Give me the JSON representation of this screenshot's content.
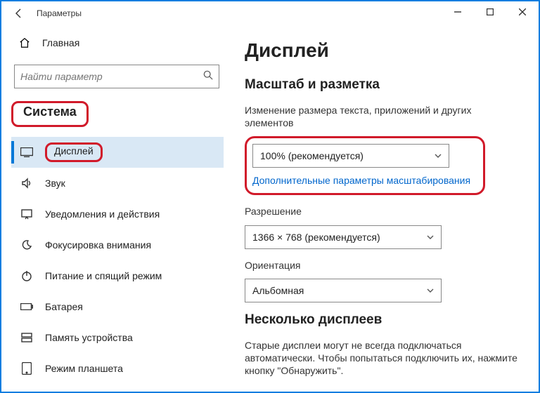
{
  "window": {
    "title": "Параметры"
  },
  "sidebar": {
    "home": "Главная",
    "search_placeholder": "Найти параметр",
    "category": "Система",
    "items": [
      {
        "label": "Дисплей"
      },
      {
        "label": "Звук"
      },
      {
        "label": "Уведомления и действия"
      },
      {
        "label": "Фокусировка внимания"
      },
      {
        "label": "Питание и спящий режим"
      },
      {
        "label": "Батарея"
      },
      {
        "label": "Память устройства"
      },
      {
        "label": "Режим планшета"
      }
    ]
  },
  "main": {
    "title": "Дисплей",
    "scale_section": "Масштаб и разметка",
    "scale_desc": "Изменение размера текста, приложений и других элементов",
    "scale_value": "100% (рекомендуется)",
    "scale_link": "Дополнительные параметры масштабирования",
    "resolution_label": "Разрешение",
    "resolution_value": "1366 × 768 (рекомендуется)",
    "orientation_label": "Ориентация",
    "orientation_value": "Альбомная",
    "multi_section": "Несколько дисплеев",
    "multi_desc": "Старые дисплеи могут не всегда подключаться автоматически. Чтобы попытаться подключить их, нажмите кнопку \"Обнаружить\"."
  }
}
